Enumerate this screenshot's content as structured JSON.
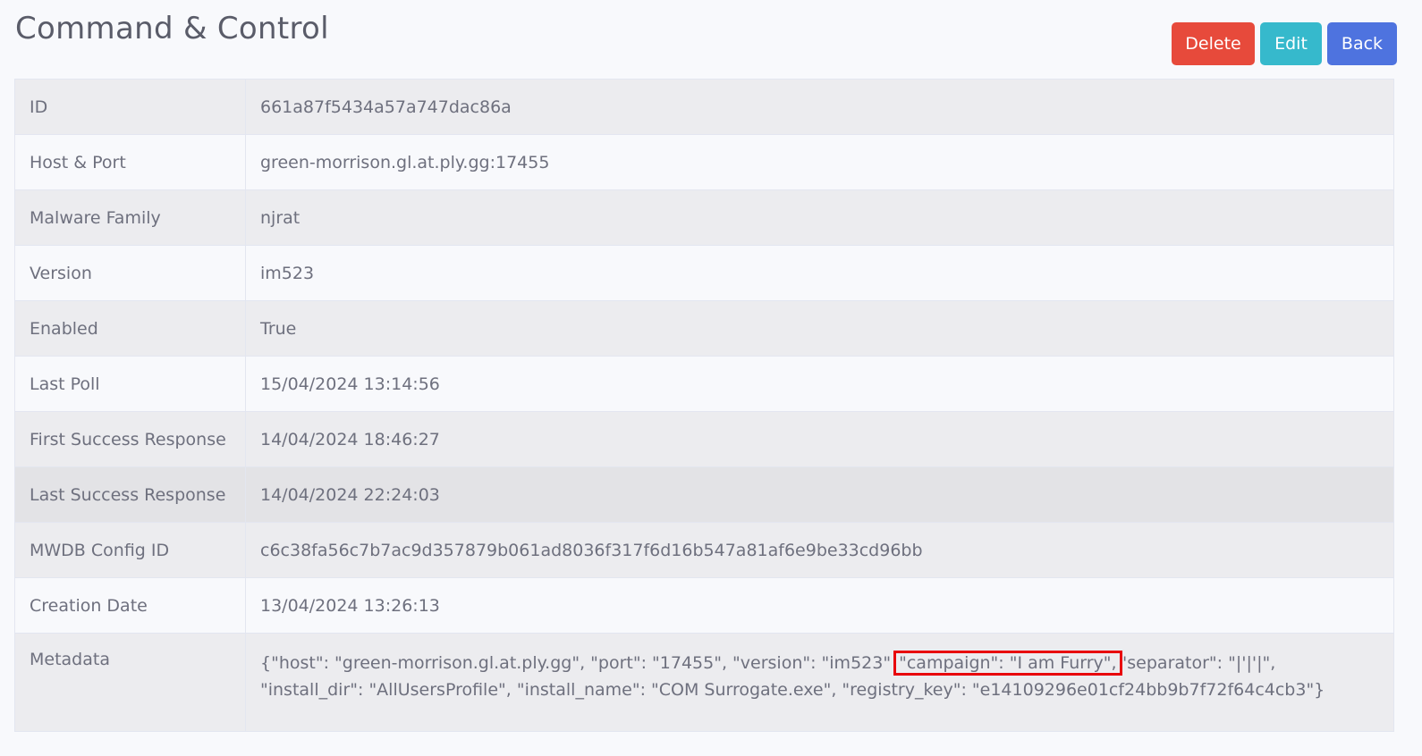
{
  "page": {
    "title": "Command & Control"
  },
  "actions": {
    "delete_label": "Delete",
    "edit_label": "Edit",
    "back_label": "Back"
  },
  "colors": {
    "delete": "#e74a3b",
    "edit": "#36b9cc",
    "back": "#4e73df",
    "highlight_box": "#e8000b"
  },
  "details": [
    {
      "key": "ID",
      "value": "661a87f5434a57a747dac86a"
    },
    {
      "key": "Host & Port",
      "value": "green-morrison.gl.at.ply.gg:17455"
    },
    {
      "key": "Malware Family",
      "value": "njrat"
    },
    {
      "key": "Version",
      "value": "im523"
    },
    {
      "key": "Enabled",
      "value": "True"
    },
    {
      "key": "Last Poll",
      "value": "15/04/2024 13:14:56"
    },
    {
      "key": "First Success Response",
      "value": "14/04/2024 18:46:27"
    },
    {
      "key": "Last Success Response",
      "value": "14/04/2024 22:24:03"
    },
    {
      "key": "MWDB Config ID",
      "value": "c6c38fa56c7b7ac9d357879b061ad8036f317f6d16b547a81af6e9be33cd96bb"
    },
    {
      "key": "Creation Date",
      "value": "13/04/2024 13:26:13"
    }
  ],
  "metadata": {
    "key": "Metadata",
    "before": "{\"host\": \"green-morrison.gl.at.ply.gg\", \"port\": \"17455\", \"version\": \"im523\"",
    "highlighted": "\"campaign\": \"I am Furry\",",
    "after": "\"separator\": \"|'|'|\", \"install_dir\": \"AllUsersProfile\", \"install_name\": \"COM Surrogate.exe\", \"registry_key\": \"e14109296e01cf24bb9b7f72f64c4cb3\"}"
  }
}
